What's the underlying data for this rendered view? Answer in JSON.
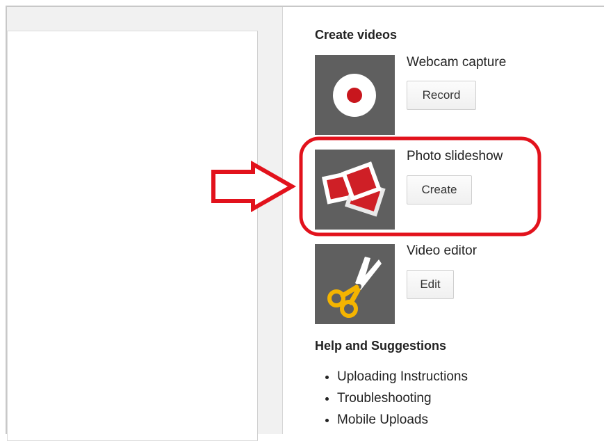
{
  "create_videos": {
    "heading": "Create videos",
    "items": [
      {
        "title": "Webcam capture",
        "button": "Record",
        "icon": "record-icon"
      },
      {
        "title": "Photo slideshow",
        "button": "Create",
        "icon": "slideshow-icon"
      },
      {
        "title": "Video editor",
        "button": "Edit",
        "icon": "scissors-icon"
      }
    ]
  },
  "help": {
    "heading": "Help and Suggestions",
    "links": [
      "Uploading Instructions",
      "Troubleshooting",
      "Mobile Uploads"
    ]
  },
  "colors": {
    "thumb_bg": "#5f5f5f",
    "record_red": "#c8161d",
    "slide_red": "#cf1f26",
    "scissors_yellow": "#f4b400",
    "annotation_red": "#e2121c"
  }
}
